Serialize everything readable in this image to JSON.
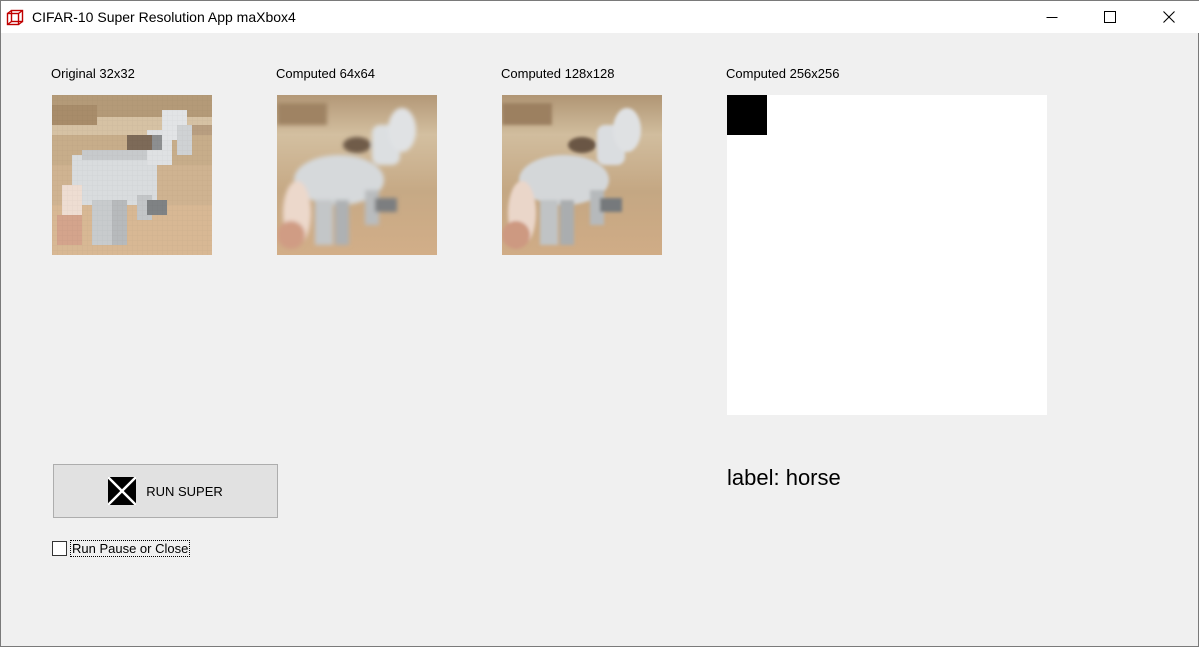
{
  "window": {
    "title": "CIFAR-10 Super Resolution App maXbox4",
    "app_icon": "maxbox-cube-icon",
    "controls": [
      "minimize-icon",
      "maximize-icon",
      "close-icon"
    ]
  },
  "images": {
    "original_label": "Original 32x32",
    "computed64_label": "Computed 64x64",
    "computed128_label": "Computed 128x128",
    "computed256_label": "Computed 256x256"
  },
  "run_button": {
    "label": "RUN SUPER",
    "icon": "x-cross-icon"
  },
  "checkbox": {
    "label": "Run Pause or Close",
    "checked": false
  },
  "result": {
    "label": "label: horse"
  },
  "colors": {
    "window_bg": "#f0f0f0",
    "titlebar_bg": "#ffffff",
    "button_bg": "#e1e1e1",
    "icon_red": "#c00000"
  }
}
